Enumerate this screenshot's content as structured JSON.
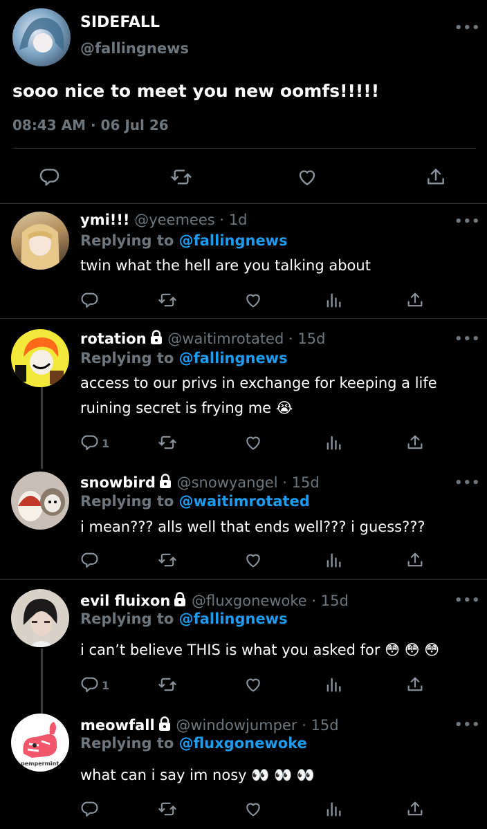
{
  "main_tweet": {
    "display_name": "SIDEFALL",
    "handle": "@fallingnews",
    "text": "sooo nice to meet you new oomfs!!!!!",
    "timestamp": "08:43 AM · 06 Jul 26",
    "more": "•••"
  },
  "replies": [
    {
      "display_name": "ymi!!!",
      "handle": "@yeemees",
      "age": "· 1d",
      "reply_prefix": "Replying to",
      "reply_to": "@fallingnews",
      "text": "twin what the hell are you talking about",
      "reply_count": "",
      "locked": false
    },
    {
      "display_name": "rotation",
      "handle": "@waitimrotated",
      "age": "· 15d",
      "reply_prefix": "Replying to",
      "reply_to": "@fallingnews",
      "text_line1": "access to our privs in exchange for keeping a life",
      "text_line2": "ruining secret is frying me 😭",
      "reply_count": "1",
      "locked": true
    },
    {
      "display_name": "snowbird",
      "handle": "@snowyangel",
      "age": "· 15d",
      "reply_prefix": "Replying to",
      "reply_to": "@waitimrotated",
      "text": "i mean??? alls well that ends well??? i guess???",
      "reply_count": "",
      "locked": true
    },
    {
      "display_name": "evil fluixon",
      "handle": "@fluxgonewoke",
      "age": "· 15d",
      "reply_prefix": "Replying to",
      "reply_to": "@fallingnews",
      "text": "i can’t believe THIS is what you asked for 😳 😳 😳",
      "reply_count": "1",
      "locked": true
    },
    {
      "display_name": "meowfall",
      "handle": "@windowjumper",
      "age": "· 15d",
      "reply_prefix": "Replying to",
      "reply_to": "@fluxgonewoke",
      "text": "what can i say im nosy 👀 👀 👀",
      "reply_count": "",
      "locked": true,
      "avatar_caption": "pempermint"
    }
  ],
  "colors": {
    "accent": "#1d9bf0",
    "muted": "#6e767d",
    "background": "#000000",
    "divider": "#2f3336"
  },
  "icons": [
    "comment-icon",
    "retweet-icon",
    "like-icon",
    "views-icon",
    "share-icon",
    "lock-icon",
    "more-icon"
  ]
}
